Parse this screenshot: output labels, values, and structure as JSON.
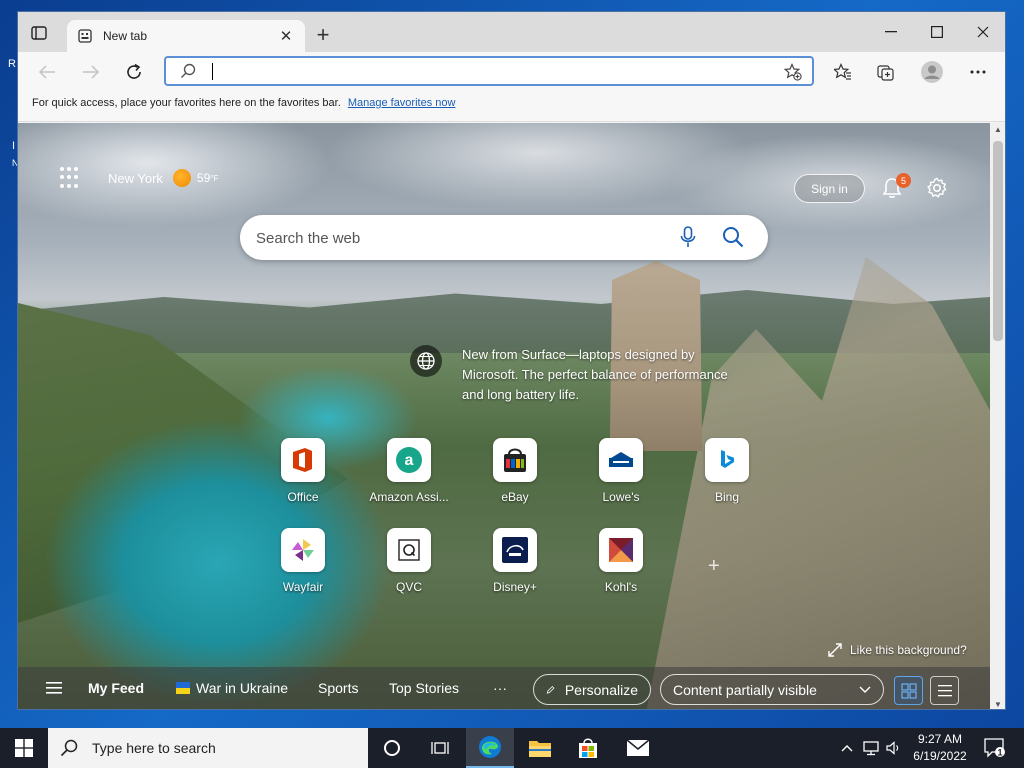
{
  "desktop": {
    "glyph_r": "R",
    "glyph_l": "I",
    "glyph_n": "N"
  },
  "browser": {
    "tab": {
      "title": "New tab"
    },
    "address": {
      "value": "",
      "placeholder": ""
    },
    "favorites_bar": {
      "message": "For quick access, place your favorites here on the favorites bar.",
      "link": "Manage favorites now"
    }
  },
  "newtab": {
    "weather": {
      "city": "New York",
      "temp": "59",
      "unit": "°F"
    },
    "sign_in": "Sign in",
    "notifications_count": "5",
    "search": {
      "placeholder": "Search the web"
    },
    "promo": "New from Surface—laptops designed by Microsoft. The perfect balance of performance and long battery life.",
    "tiles": [
      {
        "label": "Office",
        "icon": "office-icon"
      },
      {
        "label": "Amazon Assi...",
        "icon": "amazon-icon"
      },
      {
        "label": "eBay",
        "icon": "ebay-icon"
      },
      {
        "label": "Lowe's",
        "icon": "lowes-icon"
      },
      {
        "label": "Bing",
        "icon": "bing-icon"
      },
      {
        "label": "Wayfair",
        "icon": "wayfair-icon"
      },
      {
        "label": "QVC",
        "icon": "qvc-icon"
      },
      {
        "label": "Disney+",
        "icon": "disney-icon"
      },
      {
        "label": "Kohl's",
        "icon": "kohls-icon"
      }
    ],
    "like_background": "Like this background?",
    "feed": {
      "my_feed": "My Feed",
      "items": [
        "War in Ukraine",
        "Sports",
        "Top Stories"
      ],
      "more": "···",
      "personalize": "Personalize",
      "content_visibility": "Content partially visible"
    }
  },
  "taskbar": {
    "search_placeholder": "Type here to search",
    "time": "9:27 AM",
    "date": "6/19/2022",
    "notification_count": "1"
  }
}
